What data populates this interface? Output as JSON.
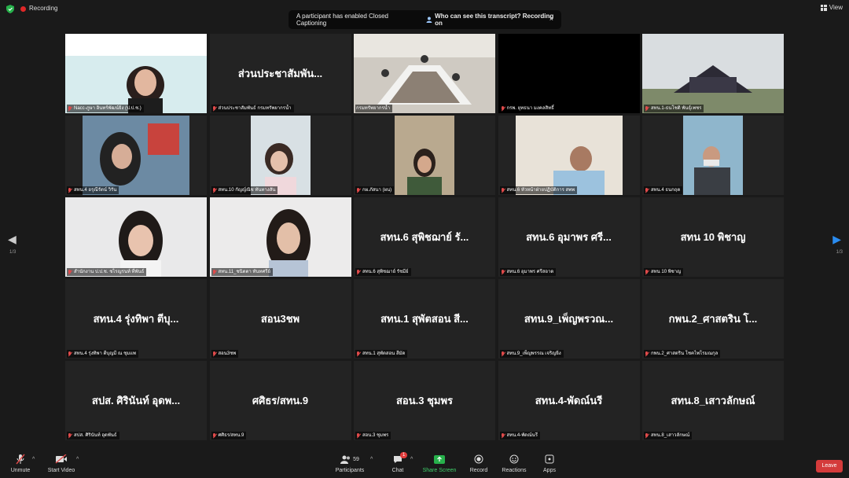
{
  "topbar": {
    "recording_label": "Recording",
    "view_label": "View"
  },
  "notice": {
    "message": "A participant has enabled Closed Captioning",
    "question": "Who can see this transcript? Recording on",
    "close": "×"
  },
  "nav": {
    "left_arrow": "◀",
    "right_arrow": "▶",
    "page_left": "1/3",
    "page_right": "1/3"
  },
  "tiles": [
    {
      "big": "",
      "label": "Nacc-ภูษา อินทร์พัฒน์ยิ่ง (ป.ป.ช.)"
    },
    {
      "big": "ส่วนประชาสัมพัน...",
      "label": "ส่วนประชาสัมพันธ์ กรมทรัพยากรน้ำ"
    },
    {
      "big": "",
      "label": "กรมทรัพยากรน้ำ"
    },
    {
      "big": "",
      "label": "กรพ. ยุทธนา มงคลสิทธิ์"
    },
    {
      "big": "",
      "label": "สทน.1-ธนโชติ พันธุ์เพชร"
    },
    {
      "big": "",
      "label": "สทน.4 อรุณีรัตน์ วิรัน"
    },
    {
      "big": "",
      "label": "สทน.10 กัญญ์ณิช ทันทางสัน"
    },
    {
      "big": "",
      "label": "กผ.ภัสนา (ผน)"
    },
    {
      "big": "",
      "label": "สทน.6 หัวหน้าฝ่ายปฏิบัติการ สพพ"
    },
    {
      "big": "",
      "label": "สทน.4 ธนกฤต"
    },
    {
      "big": "",
      "label": "สำนักงาน ป.ป.ช. ชไรญรนท์ ที่พันธ์"
    },
    {
      "big": "",
      "label": "สทน.11_ชนิตตา ทันทศรีย์"
    },
    {
      "big": "สทน.6 สุพิชฌาย์ รั...",
      "label": "สทน.6 สุพิชฌาย์ รัชมีย์"
    },
    {
      "big": "สทน.6 อุมาพร ศรี...",
      "label": "สทน.6 อุมาพร ศรีสอาด"
    },
    {
      "big": "สทน 10 พิชาญ",
      "label": "สทน 10 พิชาญ"
    },
    {
      "big": "สทน.4 รุ่งทิพา ตีบุ...",
      "label": "สทน.4 รุ่งทิพา ตีบุญมี ณ ชุมแพ"
    },
    {
      "big": "สอน3ชพ",
      "label": "สอน3ชพ"
    },
    {
      "big": "สทน.1 สุพัตสอน สี...",
      "label": "สทน.1 สุพัตสอน สีมัด"
    },
    {
      "big": "สทน.9_เพ็ญพรวณ...",
      "label": "สทน.9_เพ็ญพรรณ เจริญยิ่ง"
    },
    {
      "big": "กพน.2_ศาสตริน โ...",
      "label": "กพน.2_ศาสตริน โชคไพโรมณกุล"
    },
    {
      "big": "สปส. ศิรินันท์ อุดพ...",
      "label": "สปส. ศิรินันท์ อุดพันธ์"
    },
    {
      "big": "ศศิธร/สทน.9",
      "label": "ศศิธร/สทน.9"
    },
    {
      "big": "สอน.3 ชุมพร",
      "label": "สอน.3 ชุมพร"
    },
    {
      "big": "สทน.4-พัดณ์นรี",
      "label": "สทน.4-พัดณ์นรี"
    },
    {
      "big": "สทน.8_เสาวลักษณ์",
      "label": "สทน.8_เสาวลักษณ์"
    }
  ],
  "toolbar": {
    "unmute": "Unmute",
    "start_video": "Start Video",
    "participants": "Participants",
    "participants_count": "59",
    "chat": "Chat",
    "chat_badge": "1",
    "share_screen": "Share Screen",
    "record": "Record",
    "reactions": "Reactions",
    "apps": "Apps",
    "leave": "Leave"
  },
  "colors": {
    "accent_blue": "#2a8cf0",
    "share_green": "#3fd06a",
    "leave_red": "#d43b3b",
    "active_speaker": "#d8e06a"
  }
}
